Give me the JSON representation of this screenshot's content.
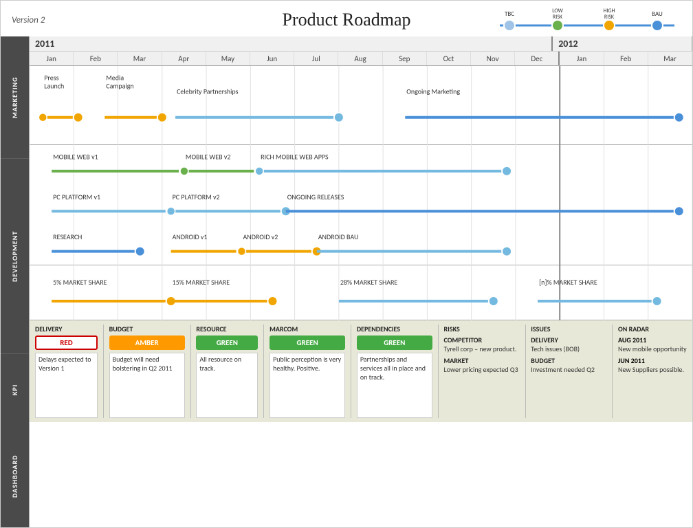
{
  "header": {
    "version": "Version 2",
    "title": "Product Roadmap"
  },
  "legend": {
    "items": [
      {
        "label": "TBC",
        "color": "#a0c4e8",
        "lineColor": "#a0c4e8"
      },
      {
        "label": "LOW RISK",
        "color": "#6ab04c",
        "lineColor": "#6ab04c"
      },
      {
        "label": "HIGH RISK",
        "color": "#f0a500",
        "lineColor": "#f0a500"
      },
      {
        "label": "BAU",
        "color": "#4a90d9",
        "lineColor": "#4a90d9"
      }
    ]
  },
  "years": [
    {
      "label": "2011",
      "span": 12
    },
    {
      "label": "2012",
      "span": 3
    }
  ],
  "months": [
    "Jan",
    "Feb",
    "Mar",
    "Apr",
    "May",
    "Jun",
    "Jul",
    "Aug",
    "Sep",
    "Oct",
    "Nov",
    "Dec",
    "Jan",
    "Feb",
    "Mar"
  ],
  "sections": {
    "marketing": {
      "label": "MARKETING",
      "rows": [
        {
          "items": [
            {
              "label": "Press\nLaunch",
              "startMonth": 0.3,
              "endMonth": 1.1,
              "type": "orange",
              "dotStart": true,
              "dotEnd": true,
              "textAbove": true
            },
            {
              "label": "Media\nCampaign",
              "startMonth": 1.7,
              "endMonth": 3.0,
              "type": "orange",
              "dotStart": false,
              "dotEnd": true,
              "textAbove": true
            },
            {
              "label": "Celebrity Partnerships",
              "startMonth": 3.3,
              "endMonth": 7.0,
              "type": "lightblue",
              "dotStart": false,
              "dotEnd": true,
              "textAbove": false
            },
            {
              "label": "Ongoing Marketing",
              "startMonth": 8.5,
              "endMonth": 14.7,
              "type": "blue",
              "dotStart": false,
              "dotEnd": true,
              "textAbove": false
            }
          ]
        }
      ]
    },
    "development": {
      "label": "DEVELOPMENT",
      "rows": [
        {
          "items": [
            {
              "label": "MOBILE WEB v1",
              "startMonth": 0.5,
              "endMonth": 3.5,
              "type": "green",
              "dotStart": false,
              "dotEnd": true,
              "textAbove": false
            },
            {
              "label": "MOBILE WEB v2",
              "startMonth": 3.5,
              "endMonth": 5.2,
              "type": "green",
              "dotStart": true,
              "dotEnd": true,
              "textAbove": false
            },
            {
              "label": "RICH MOBILE WEB APPS",
              "startMonth": 5.2,
              "endMonth": 10.8,
              "type": "lightblue",
              "dotStart": true,
              "dotEnd": true,
              "textAbove": false
            }
          ]
        },
        {
          "items": [
            {
              "label": "PC PLATFORM  v1",
              "startMonth": 0.5,
              "endMonth": 3.2,
              "type": "lightblue",
              "dotStart": false,
              "dotEnd": true,
              "textAbove": false
            },
            {
              "label": "PC PLATFORM  v2",
              "startMonth": 3.2,
              "endMonth": 5.8,
              "type": "lightblue",
              "dotStart": true,
              "dotEnd": true,
              "textAbove": false
            },
            {
              "label": "ONGOING RELEASES",
              "startMonth": 5.8,
              "endMonth": 14.7,
              "type": "blue",
              "dotStart": false,
              "dotEnd": true,
              "textAbove": false
            }
          ]
        },
        {
          "items": [
            {
              "label": "RESEARCH",
              "startMonth": 0.5,
              "endMonth": 2.5,
              "type": "blue",
              "dotStart": false,
              "dotEnd": true,
              "textAbove": false
            },
            {
              "label": "ANDROID v1",
              "startMonth": 3.2,
              "endMonth": 4.8,
              "type": "orange",
              "dotStart": false,
              "dotEnd": true,
              "textAbove": false
            },
            {
              "label": "ANDROID v2",
              "startMonth": 4.8,
              "endMonth": 6.5,
              "type": "orange",
              "dotStart": true,
              "dotEnd": true,
              "textAbove": false
            },
            {
              "label": "ANDROID BAU",
              "startMonth": 6.5,
              "endMonth": 10.8,
              "type": "lightblue",
              "dotStart": false,
              "dotEnd": true,
              "textAbove": false
            }
          ]
        }
      ]
    },
    "kpi": {
      "label": "KPI",
      "rows": [
        {
          "items": [
            {
              "label": "5% MARKET  SHARE",
              "startMonth": 0.5,
              "endMonth": 3.2,
              "type": "orange",
              "dotStart": false,
              "dotEnd": true,
              "textAbove": false
            },
            {
              "label": "15% MARKET  SHARE",
              "startMonth": 3.2,
              "endMonth": 5.5,
              "type": "orange",
              "dotStart": false,
              "dotEnd": true,
              "textAbove": false
            },
            {
              "label": "28% MARKET  SHARE",
              "startMonth": 7.0,
              "endMonth": 10.5,
              "type": "lightblue",
              "dotStart": false,
              "dotEnd": true,
              "textAbove": false
            },
            {
              "label": "[n]% MARKET  SHARE",
              "startMonth": 11.5,
              "endMonth": 14.2,
              "type": "lightblue",
              "dotStart": false,
              "dotEnd": true,
              "textAbove": false
            }
          ]
        }
      ]
    }
  },
  "dashboard": {
    "columns": [
      {
        "header": "DELIVERY",
        "badge": "RED",
        "badgeType": "red",
        "text": "Delays expected to Version 1"
      },
      {
        "header": "BUDGET",
        "badge": "AMBER",
        "badgeType": "amber",
        "text": "Budget will need bolstering in Q2 2011"
      },
      {
        "header": "RESOURCE",
        "badge": "GREEN",
        "badgeType": "green",
        "text": "All resource on track."
      },
      {
        "header": "MARCOM",
        "badge": "GREEN",
        "badgeType": "green",
        "text": "Public perception is very healthy. Positive."
      },
      {
        "header": "DEPENDENCIES",
        "badge": "GREEN",
        "badgeType": "green",
        "text": "Partnerships and services all in place and on track."
      }
    ],
    "risks": {
      "header": "RISKS",
      "items": [
        {
          "label": "COMPETITOR",
          "text": "Tyrell corp – new product."
        },
        {
          "label": "MARKET",
          "text": "Lower pricing expected Q3"
        }
      ]
    },
    "issues": {
      "header": "ISSUES",
      "items": [
        {
          "label": "DELIVERY",
          "text": "Tech issues (BOB)"
        },
        {
          "label": "BUDGET",
          "text": "Investment needed Q2"
        }
      ]
    },
    "onRadar": {
      "header": "ON RADAR",
      "items": [
        {
          "date": "AUG 2011",
          "text": "New mobile opportunity"
        },
        {
          "date": "JUN 2011",
          "text": "New Suppliers possible."
        }
      ]
    }
  }
}
